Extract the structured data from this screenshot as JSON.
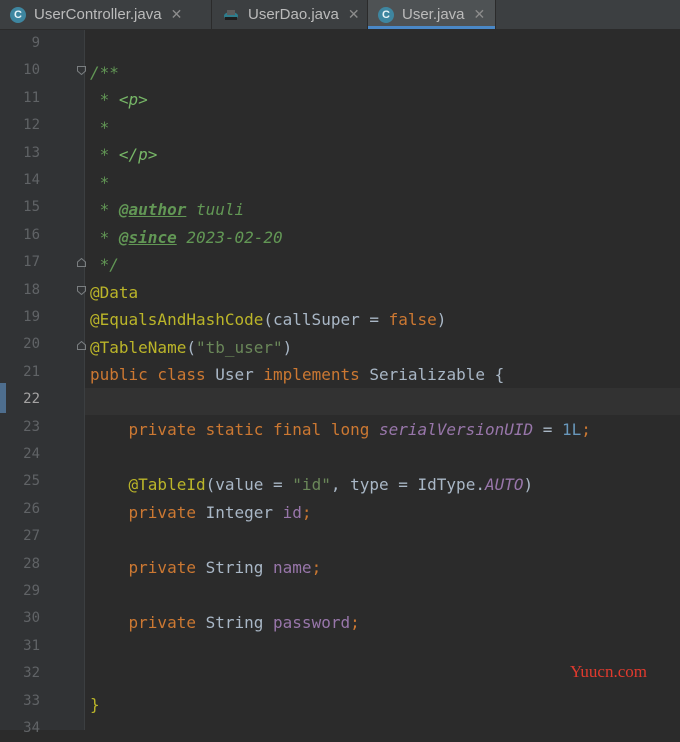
{
  "tabs": [
    {
      "label": "UserController.java",
      "icon": "class-icon",
      "active": false
    },
    {
      "label": "UserDao.java",
      "icon": "interface-icon",
      "active": false
    },
    {
      "label": "User.java",
      "icon": "class-icon",
      "active": true
    }
  ],
  "icon_letter": "C",
  "close_glyph": "✕",
  "line_numbers": [
    "9",
    "10",
    "11",
    "12",
    "13",
    "14",
    "15",
    "16",
    "17",
    "18",
    "19",
    "20",
    "21",
    "22",
    "23",
    "24",
    "25",
    "26",
    "27",
    "28",
    "29",
    "30",
    "31",
    "32",
    "33",
    "34"
  ],
  "code": {
    "l10": "/**",
    "l11a": " * ",
    "l11b": "<p>",
    "l12": " *",
    "l13a": " * ",
    "l13b": "</p>",
    "l14": " *",
    "l15a": " * ",
    "l15b": "@author",
    "l15c": " tuuli",
    "l16a": " * ",
    "l16b": "@since",
    "l16c": " 2023-02-20",
    "l17": " */",
    "l18": "@Data",
    "l19a": "@EqualsAndHashCode",
    "l19b": "(callSuper = ",
    "l19c": "false",
    "l19d": ")",
    "l20a": "@TableName",
    "l20b": "(",
    "l20c": "\"tb_user\"",
    "l20d": ")",
    "l21a": "public class ",
    "l21b": "User ",
    "l21c": "implements ",
    "l21d": "Serializable {",
    "l23a": "    private static final long ",
    "l23b": "serialVersionUID",
    "l23c": " = ",
    "l23d": "1L",
    "l23e": ";",
    "l25a": "    @TableId",
    "l25b": "(value = ",
    "l25c": "\"id\"",
    "l25d": ", type = IdType.",
    "l25e": "AUTO",
    "l25f": ")",
    "l26a": "    private ",
    "l26b": "Integer ",
    "l26c": "id",
    "l26d": ";",
    "l28a": "    private ",
    "l28b": "String ",
    "l28c": "name",
    "l28d": ";",
    "l30a": "    private ",
    "l30b": "String ",
    "l30c": "password",
    "l30d": ";",
    "l33": "}"
  },
  "watermark": "Yuucn.com",
  "colors": {
    "keyword": "#cc7832",
    "annotation": "#bbb529",
    "string": "#6a8759",
    "number": "#6897bb",
    "comment": "#629755",
    "field": "#9876aa",
    "text": "#a9b7c6",
    "background": "#2b2b2b",
    "watermark": "#e03a2e"
  }
}
